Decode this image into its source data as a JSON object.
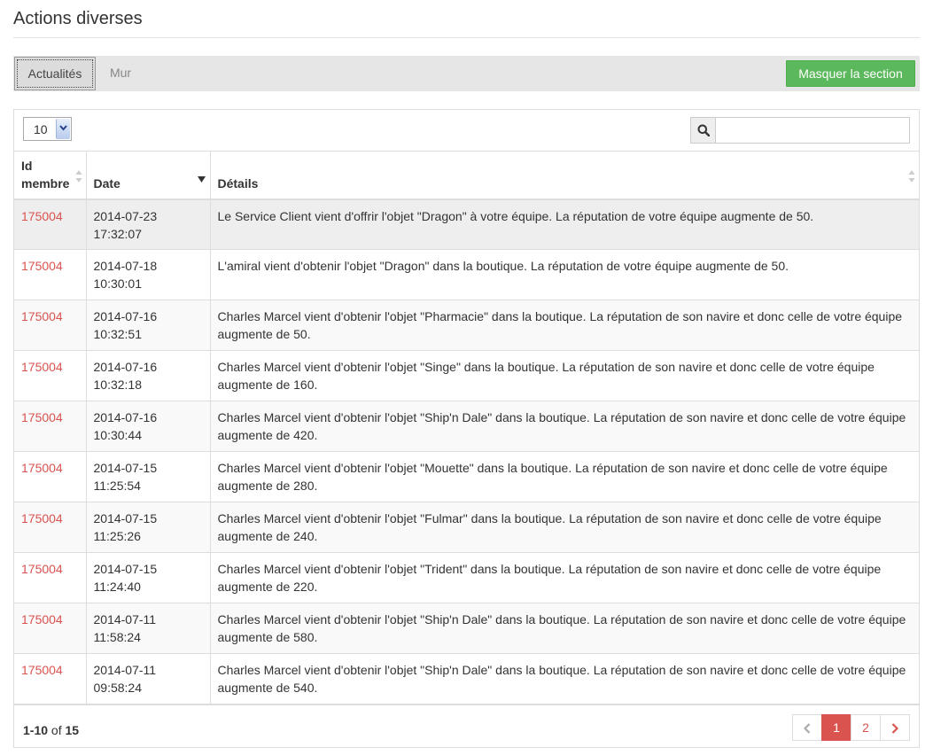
{
  "page": {
    "title": "Actions diverses"
  },
  "tabs": [
    {
      "label": "Actualités",
      "active": true
    },
    {
      "label": "Mur",
      "active": false
    }
  ],
  "hide_button": {
    "label": "Masquer la section",
    "color": "#5cb85c"
  },
  "toolbar": {
    "page_length": "10",
    "search_placeholder": "",
    "search_icon": "search-icon",
    "select_arrow_icon": "chevron-down-icon"
  },
  "table": {
    "headers": {
      "id": "Id membre",
      "date": "Date",
      "details": "Détails"
    },
    "rows": [
      {
        "id": "175004",
        "date": "2014-07-23",
        "time": "17:32:07",
        "details": "Le Service Client vient d'offrir l'objet \"Dragon\" à votre équipe. La réputation de votre équipe augmente de 50."
      },
      {
        "id": "175004",
        "date": "2014-07-18",
        "time": "10:30:01",
        "details": "L'amiral vient d'obtenir l'objet \"Dragon\" dans la boutique. La réputation de votre équipe augmente de 50."
      },
      {
        "id": "175004",
        "date": "2014-07-16",
        "time": "10:32:51",
        "details": "Charles Marcel vient d'obtenir l'objet \"Pharmacie\" dans la boutique. La réputation de son navire et donc celle de votre équipe augmente de 50."
      },
      {
        "id": "175004",
        "date": "2014-07-16",
        "time": "10:32:18",
        "details": "Charles Marcel vient d'obtenir l'objet \"Singe\" dans la boutique. La réputation de son navire et donc celle de votre équipe augmente de 160."
      },
      {
        "id": "175004",
        "date": "2014-07-16",
        "time": "10:30:44",
        "details": "Charles Marcel vient d'obtenir l'objet \"Ship'n Dale\" dans la boutique. La réputation de son navire et donc celle de votre équipe augmente de 420."
      },
      {
        "id": "175004",
        "date": "2014-07-15",
        "time": "11:25:54",
        "details": "Charles Marcel vient d'obtenir l'objet \"Mouette\" dans la boutique. La réputation de son navire et donc celle de votre équipe augmente de 280."
      },
      {
        "id": "175004",
        "date": "2014-07-15",
        "time": "11:25:26",
        "details": "Charles Marcel vient d'obtenir l'objet \"Fulmar\" dans la boutique. La réputation de son navire et donc celle de votre équipe augmente de 240."
      },
      {
        "id": "175004",
        "date": "2014-07-15",
        "time": "11:24:40",
        "details": "Charles Marcel vient d'obtenir l'objet \"Trident\" dans la boutique. La réputation de son navire et donc celle de votre équipe augmente de 220."
      },
      {
        "id": "175004",
        "date": "2014-07-11",
        "time": "11:58:24",
        "details": "Charles Marcel vient d'obtenir l'objet \"Ship'n Dale\" dans la boutique. La réputation de son navire et donc celle de votre équipe augmente de 580."
      },
      {
        "id": "175004",
        "date": "2014-07-11",
        "time": "09:58:24",
        "details": "Charles Marcel vient d'obtenir l'objet \"Ship'n Dale\" dans la boutique. La réputation de son navire et donc celle de votre équipe augmente de 540."
      }
    ]
  },
  "footer": {
    "range": "1-10",
    "of_label": "of",
    "total": "15",
    "pages": [
      "1",
      "2"
    ],
    "current_page": "1",
    "accent_color": "#d9534f"
  }
}
